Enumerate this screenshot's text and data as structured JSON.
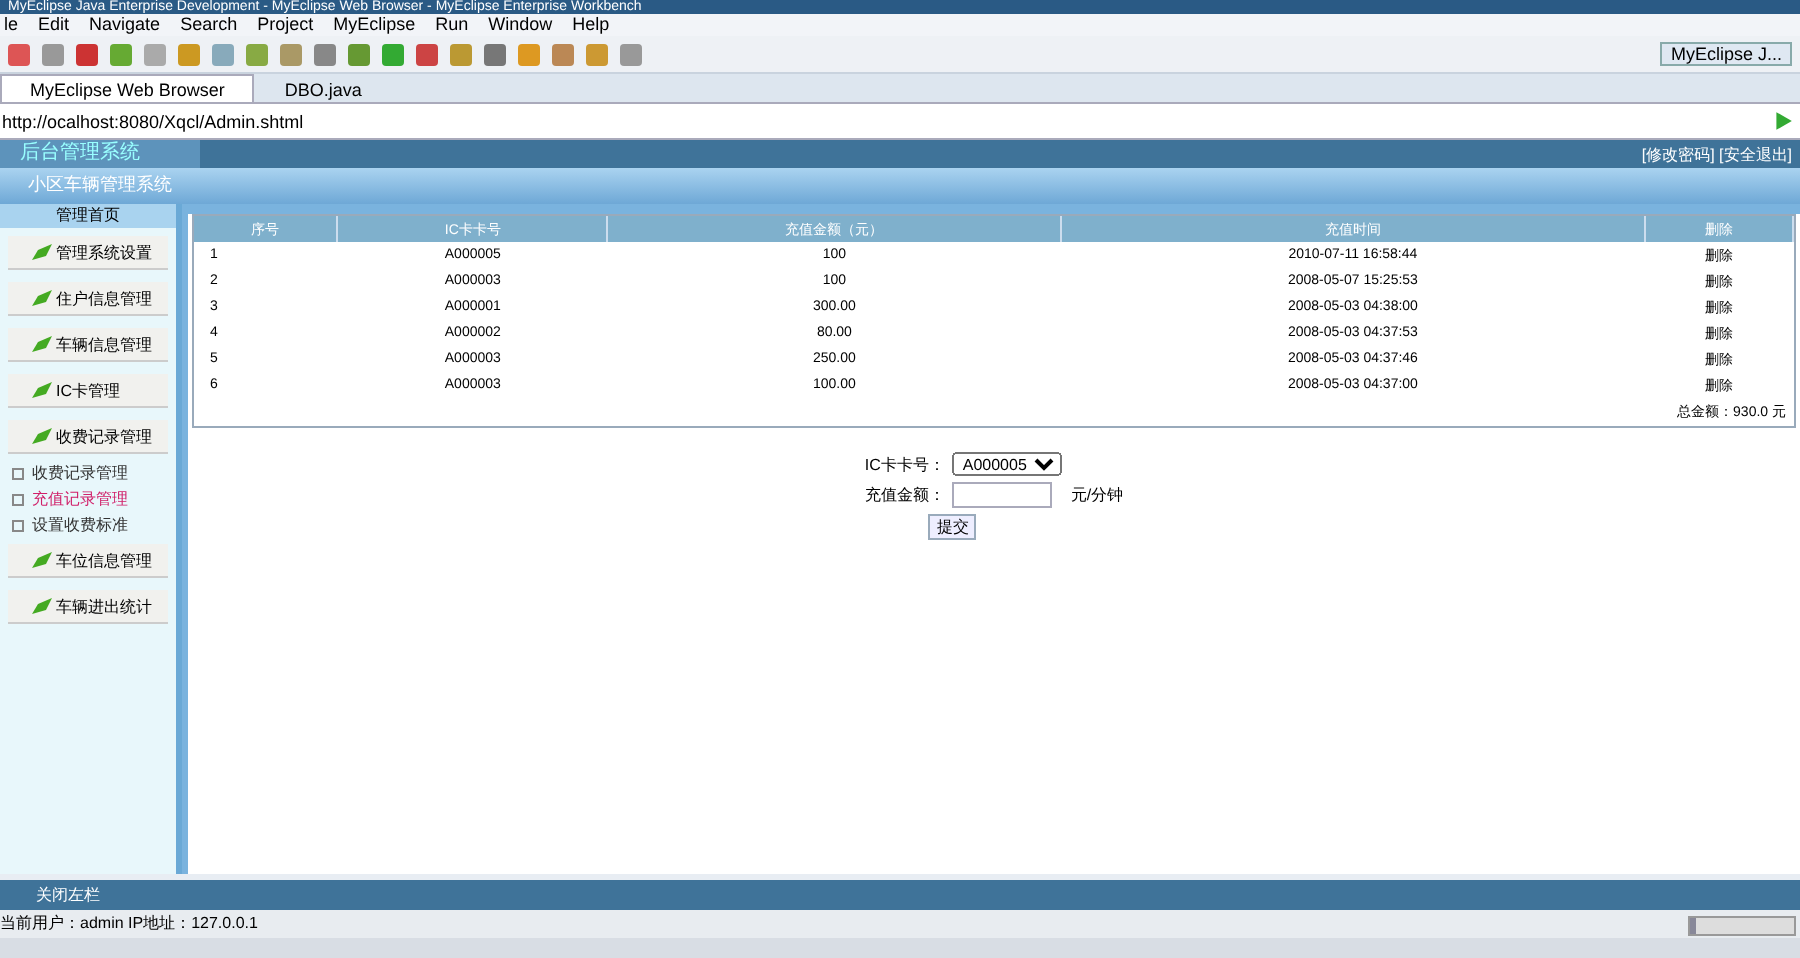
{
  "window": {
    "title": "MyEclipse Java Enterprise Development - MyEclipse Web Browser - MyEclipse Enterprise Workbench"
  },
  "menu": [
    "le",
    "Edit",
    "Navigate",
    "Search",
    "Project",
    "MyEclipse",
    "Run",
    "Window",
    "Help"
  ],
  "perspective": "MyEclipse J...",
  "editor_tabs": [
    {
      "label": "MyEclipse Web Browser",
      "selected": true
    },
    {
      "label": "DBO.java",
      "selected": false
    }
  ],
  "address": "http://ocalhost:8080/Xqcl/Admin.shtml",
  "page": {
    "site_title": "后台管理系统",
    "subtitle": "小区车辆管理系统",
    "header_links": "[修改密码] [安全退出]",
    "sidebar": {
      "title": "管理首页",
      "items": [
        {
          "kind": "button",
          "label": "管理系统设置",
          "selected": false
        },
        {
          "kind": "button",
          "label": "住户信息管理",
          "selected": false
        },
        {
          "kind": "button",
          "label": "车辆信息管理",
          "selected": false
        },
        {
          "kind": "button",
          "label": "IC卡管理",
          "selected": false
        },
        {
          "kind": "button",
          "label": "收费记录管理",
          "selected": false
        },
        {
          "kind": "link",
          "label": "收费记录管理",
          "selected": false
        },
        {
          "kind": "link",
          "label": "充值记录管理",
          "selected": true
        },
        {
          "kind": "link",
          "label": "设置收费标准",
          "selected": false
        },
        {
          "kind": "button",
          "label": "车位信息管理",
          "selected": false
        },
        {
          "kind": "button",
          "label": "车辆进出统计",
          "selected": false
        }
      ]
    },
    "table": {
      "columns": [
        "序号",
        "IC卡卡号",
        "充值金额（元）",
        "充值时间",
        "删除"
      ],
      "rows": [
        [
          "1",
          "A000005",
          "100",
          "2010-07-11 16:58:44",
          "删除"
        ],
        [
          "2",
          "A000003",
          "100",
          "2008-05-07 15:25:53",
          "删除"
        ],
        [
          "3",
          "A000001",
          "300.00",
          "2008-05-03 04:38:00",
          "删除"
        ],
        [
          "4",
          "A000002",
          "80.00",
          "2008-05-03 04:37:53",
          "删除"
        ],
        [
          "5",
          "A000003",
          "250.00",
          "2008-05-03 04:37:46",
          "删除"
        ],
        [
          "6",
          "A000003",
          "100.00",
          "2008-05-03 04:37:00",
          "删除"
        ]
      ],
      "total": "总金额：930.0 元"
    },
    "form": {
      "card_label": "IC卡卡号：",
      "card_value": "A000005",
      "amount_label": "充值金额：",
      "amount_unit": "元/分钟",
      "submit": "提交"
    },
    "footer_toggle": "关闭左栏",
    "status": "当前用户：admin  IP地址：127.0.0.1"
  },
  "memory_bar": {
    "level": 0.05
  }
}
